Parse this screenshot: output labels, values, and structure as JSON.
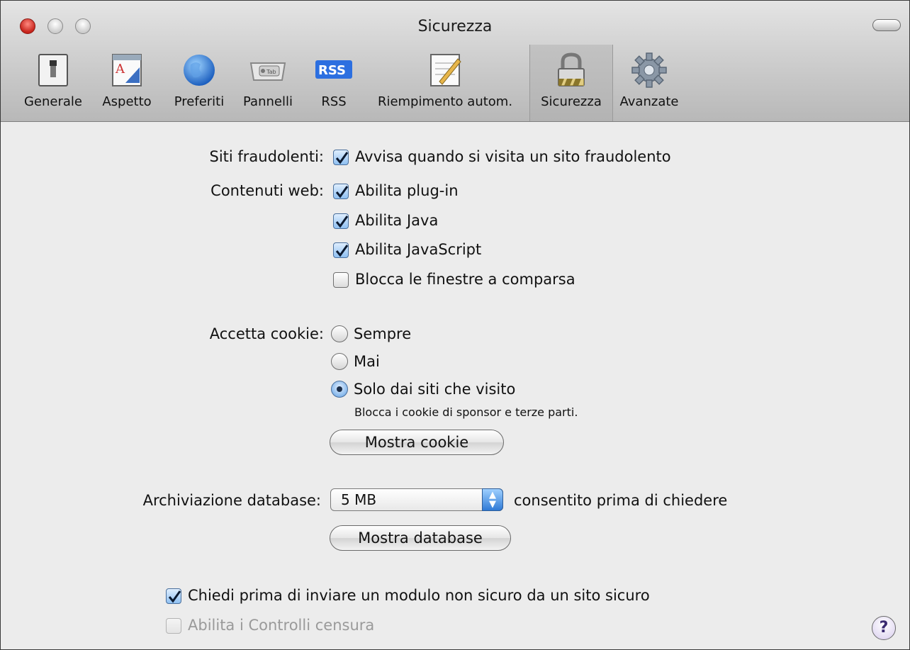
{
  "window": {
    "title": "Sicurezza"
  },
  "toolbar": {
    "items": [
      {
        "label": "Generale",
        "icon": "switch-icon"
      },
      {
        "label": "Aspetto",
        "icon": "appearance-icon"
      },
      {
        "label": "Preferiti",
        "icon": "globe-icon"
      },
      {
        "label": "Pannelli",
        "icon": "tab-icon"
      },
      {
        "label": "RSS",
        "icon": "rss-icon"
      },
      {
        "label": "Riempimento autom.",
        "icon": "autofill-icon"
      },
      {
        "label": "Sicurezza",
        "icon": "lock-icon"
      },
      {
        "label": "Avanzate",
        "icon": "gear-icon"
      }
    ],
    "selected": "Sicurezza"
  },
  "fraud": {
    "label": "Siti fraudolenti:",
    "warn": {
      "label": "Avvisa quando si visita un sito fraudolento",
      "checked": true
    }
  },
  "web_content": {
    "label": "Contenuti web:",
    "options": [
      {
        "label": "Abilita plug-in",
        "checked": true
      },
      {
        "label": "Abilita Java",
        "checked": true
      },
      {
        "label": "Abilita JavaScript",
        "checked": true
      },
      {
        "label": "Blocca le finestre a comparsa",
        "checked": false
      }
    ]
  },
  "cookies": {
    "label": "Accetta cookie:",
    "options": [
      {
        "label": "Sempre",
        "selected": false
      },
      {
        "label": "Mai",
        "selected": false
      },
      {
        "label": "Solo dai siti che visito",
        "selected": true
      }
    ],
    "note": "Blocca i cookie di sponsor e terze parti.",
    "show_button": "Mostra cookie"
  },
  "database": {
    "label": "Archiviazione database:",
    "value": "5 MB",
    "suffix": "consentito prima di chiedere",
    "show_button": "Mostra database"
  },
  "form_warning": {
    "label": "Chiedi prima di inviare un modulo non sicuro da un sito sicuro",
    "checked": true
  },
  "parental": {
    "label": "Abilita i Controlli censura",
    "checked": false,
    "enabled": false
  },
  "help": {
    "label": "?"
  }
}
